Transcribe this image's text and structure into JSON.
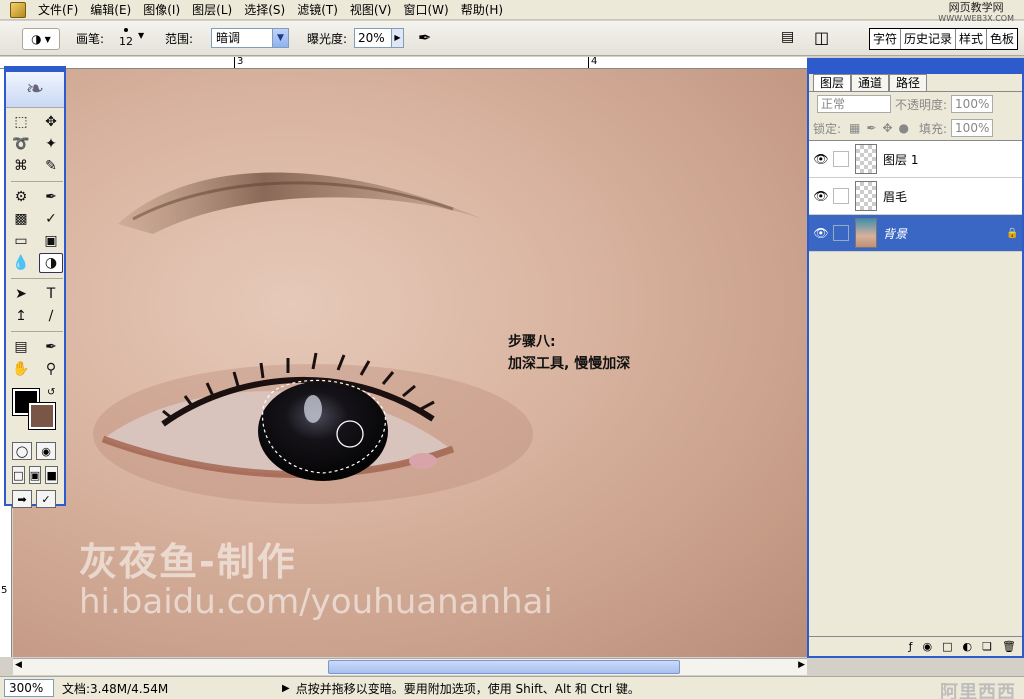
{
  "menubar": {
    "items": [
      "文件(F)",
      "编辑(E)",
      "图像(I)",
      "图层(L)",
      "选择(S)",
      "滤镜(T)",
      "视图(V)",
      "窗口(W)",
      "帮助(H)"
    ],
    "watermark_top": "网页教学网",
    "watermark_sub": "WWW.WEB3X.COM"
  },
  "options": {
    "brush_label": "画笔:",
    "brush_size": "12",
    "range_label": "范围:",
    "range_value": "暗调",
    "exposure_label": "曝光度:",
    "exposure_value": "20%",
    "palette_tabs": [
      "字符",
      "历史记录",
      "样式",
      "色板"
    ]
  },
  "ruler": {
    "top_marks": [
      "3",
      "4"
    ],
    "left_marks": [
      "5"
    ]
  },
  "canvas": {
    "annotation_line1": "步骤八:",
    "annotation_line2": "加深工具, 慢慢加深",
    "watermark_title": "灰夜鱼-制作",
    "watermark_url": "hi.baidu.com/youhuananhai"
  },
  "layers_panel": {
    "tabs": [
      "图层",
      "通道",
      "路径"
    ],
    "blend_mode": "正常",
    "opacity_label": "不透明度:",
    "opacity_value": "100%",
    "lock_label": "锁定:",
    "fill_label": "填充:",
    "fill_value": "100%",
    "layers": [
      {
        "name": "图层 1",
        "active": false
      },
      {
        "name": "眉毛",
        "active": false
      },
      {
        "name": "背景",
        "active": true
      }
    ]
  },
  "status": {
    "zoom": "300%",
    "doc_info": "文档:3.48M/4.54M",
    "hint": "点按并拖移以变暗。要用附加选项，使用 Shift、Alt 和 Ctrl 键。",
    "corner_watermark": "阿里西西"
  },
  "colors": {
    "foreground": "#000000",
    "background": "#7a5646",
    "accent": "#2e5bcc"
  }
}
